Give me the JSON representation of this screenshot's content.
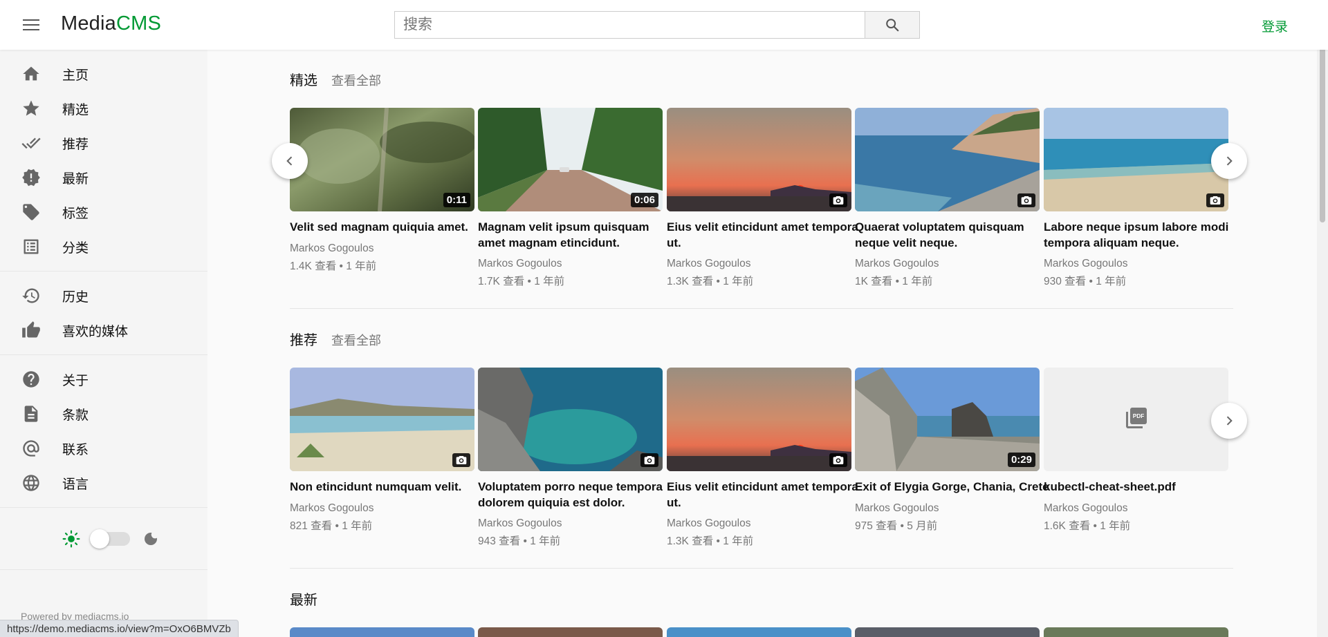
{
  "header": {
    "logo_main": "Media",
    "logo_accent": "CMS",
    "search_placeholder": "搜索",
    "login_label": "登录"
  },
  "sidebar": {
    "main_items": [
      {
        "label": "主页",
        "icon": "home-icon"
      },
      {
        "label": "精选",
        "icon": "star-icon"
      },
      {
        "label": "推荐",
        "icon": "check-icon"
      },
      {
        "label": "最新",
        "icon": "new-badge-icon"
      },
      {
        "label": "标签",
        "icon": "tag-icon"
      },
      {
        "label": "分类",
        "icon": "list-icon"
      }
    ],
    "user_items": [
      {
        "label": "历史",
        "icon": "history-icon"
      },
      {
        "label": "喜欢的媒体",
        "icon": "thumbs-up-icon"
      }
    ],
    "info_items": [
      {
        "label": "关于",
        "icon": "help-icon"
      },
      {
        "label": "条款",
        "icon": "document-icon"
      },
      {
        "label": "联系",
        "icon": "at-icon"
      },
      {
        "label": "语言",
        "icon": "globe-icon"
      }
    ],
    "powered_by": "Powered by mediacms.io"
  },
  "status_bar_url": "https://demo.mediacms.io/view?m=OxO6BMVZb",
  "sections": [
    {
      "title": "精选",
      "view_all": "查看全部",
      "items": [
        {
          "title_lines": [
            "Velit sed magnam quiquia amet."
          ],
          "author": "Markos Gogoulos",
          "meta": "1.4K 查看 • 1 年前",
          "duration": "0:11",
          "kind": "video"
        },
        {
          "title_lines": [
            "Magnam velit ipsum quisquam",
            "amet magnam etincidunt."
          ],
          "author": "Markos Gogoulos",
          "meta": "1.7K 查看 • 1 年前",
          "duration": "0:06",
          "kind": "video"
        },
        {
          "title_lines": [
            "Eius velit etincidunt amet tempora",
            "ut."
          ],
          "author": "Markos Gogoulos",
          "meta": "1.3K 查看 • 1 年前",
          "duration": "",
          "kind": "image"
        },
        {
          "title_lines": [
            "Quaerat voluptatem quisquam",
            "neque velit neque."
          ],
          "author": "Markos Gogoulos",
          "meta": "1K 查看 • 1 年前",
          "duration": "",
          "kind": "image"
        },
        {
          "title_lines": [
            "Labore neque ipsum labore modi",
            "tempora aliquam neque."
          ],
          "author": "Markos Gogoulos",
          "meta": "930 查看 • 1 年前",
          "duration": "",
          "kind": "image"
        }
      ]
    },
    {
      "title": "推荐",
      "view_all": "查看全部",
      "items": [
        {
          "title_lines": [
            "Non etincidunt numquam velit."
          ],
          "author": "Markos Gogoulos",
          "meta": "821 查看 • 1 年前",
          "duration": "",
          "kind": "image"
        },
        {
          "title_lines": [
            "Voluptatem porro neque tempora",
            "dolorem quiquia est dolor."
          ],
          "author": "Markos Gogoulos",
          "meta": "943 查看 • 1 年前",
          "duration": "",
          "kind": "image"
        },
        {
          "title_lines": [
            "Eius velit etincidunt amet tempora",
            "ut."
          ],
          "author": "Markos Gogoulos",
          "meta": "1.3K 查看 • 1 年前",
          "duration": "",
          "kind": "image"
        },
        {
          "title_lines": [
            "Exit of Elygia Gorge, Chania, Crete"
          ],
          "author": "Markos Gogoulos",
          "meta": "975 查看 • 5 月前",
          "duration": "0:29",
          "kind": "video"
        },
        {
          "title_lines": [
            "kubectl-cheat-sheet.pdf"
          ],
          "author": "Markos Gogoulos",
          "meta": "1.6K 查看 • 1 年前",
          "duration": "",
          "kind": "pdf"
        }
      ]
    },
    {
      "title": "最新",
      "view_all": "",
      "items": []
    }
  ],
  "colors": {
    "accent": "#009933",
    "sidebar_bg": "#f5f5f5",
    "page_bg": "#fafafa"
  }
}
